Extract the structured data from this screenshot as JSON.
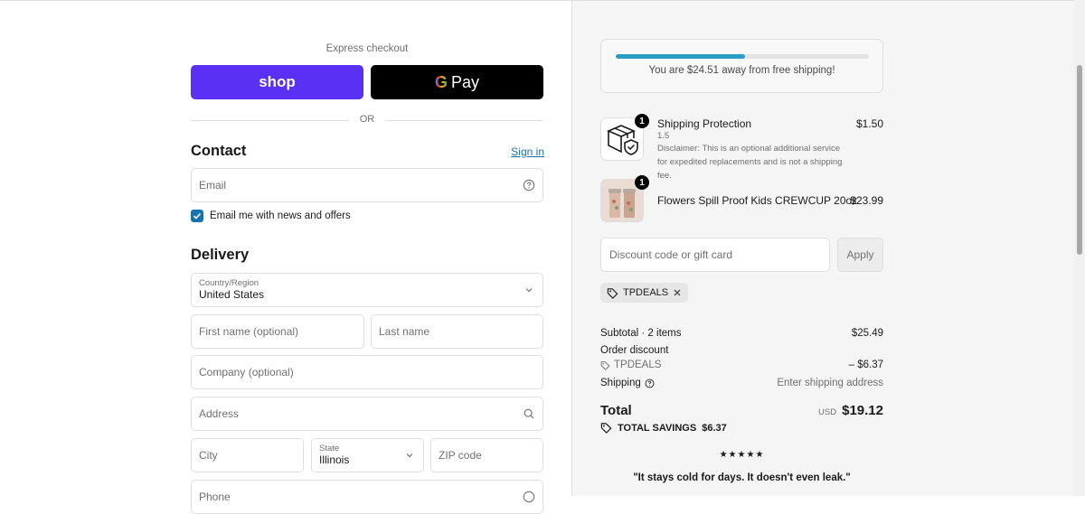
{
  "express": {
    "title": "Express checkout",
    "shop_label": "shop",
    "gpay_g": "G",
    "gpay_label": "Pay",
    "or_label": "OR"
  },
  "contact": {
    "heading": "Contact",
    "sign_in": "Sign in",
    "email_placeholder": "Email",
    "newsletter_label": "Email me with news and offers",
    "newsletter_checked": true
  },
  "delivery": {
    "heading": "Delivery",
    "country_label": "Country/Region",
    "country_value": "United States",
    "first_name_placeholder": "First name (optional)",
    "last_name_placeholder": "Last name",
    "company_placeholder": "Company (optional)",
    "address_placeholder": "Address",
    "city_placeholder": "City",
    "state_label": "State",
    "state_value": "Illinois",
    "zip_placeholder": "ZIP code",
    "phone_placeholder": "Phone"
  },
  "shipping_progress": {
    "message": "You are $24.51 away from free shipping!",
    "fraction": 0.51,
    "color": "#2a9dc4"
  },
  "items": [
    {
      "quantity": "1",
      "name": "Shipping Protection",
      "variant": "1.5",
      "note": "Disclaimer: This is an optional additional service for expedited replacements and is not a shipping fee.",
      "price": "$1.50",
      "icon": "box-shield-icon"
    },
    {
      "quantity": "1",
      "name": "Flowers Spill Proof Kids CREWCUP 20oz",
      "price": "$23.99",
      "icon": "cup-product-image"
    }
  ],
  "discount": {
    "placeholder": "Discount code or gift card",
    "apply_label": "Apply",
    "applied_code": "TPDEALS"
  },
  "summary": {
    "subtotal_label": "Subtotal · 2 items",
    "subtotal_value": "$25.49",
    "order_discount_label": "Order discount",
    "discount_code": "TPDEALS",
    "discount_value": "– $6.37",
    "shipping_label": "Shipping",
    "shipping_value": "Enter shipping address",
    "total_label": "Total",
    "currency": "USD",
    "total_value": "$19.12",
    "savings_label": "TOTAL SAVINGS",
    "savings_value": "$6.37"
  },
  "review": {
    "stars": "★★★★★",
    "quote": "\"It stays cold for days. It doesn't even leak.\""
  },
  "colors": {
    "shop_purple": "#5a31f4",
    "link_blue": "#1773b0",
    "checkbox_blue": "#1773b0"
  }
}
